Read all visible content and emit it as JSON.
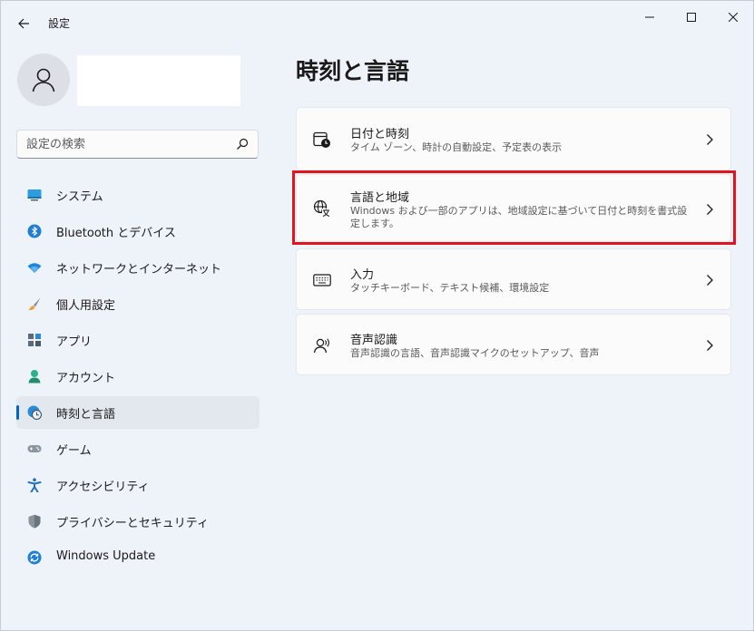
{
  "window": {
    "title": "設定"
  },
  "search": {
    "placeholder": "設定の検索"
  },
  "nav": {
    "items": [
      {
        "label": "システム"
      },
      {
        "label": "Bluetooth とデバイス"
      },
      {
        "label": "ネットワークとインターネット"
      },
      {
        "label": "個人用設定"
      },
      {
        "label": "アプリ"
      },
      {
        "label": "アカウント"
      },
      {
        "label": "時刻と言語"
      },
      {
        "label": "ゲーム"
      },
      {
        "label": "アクセシビリティ"
      },
      {
        "label": "プライバシーとセキュリティ"
      },
      {
        "label": "Windows Update"
      }
    ],
    "selected": "時刻と言語"
  },
  "main": {
    "title": "時刻と言語",
    "cards": [
      {
        "title": "日付と時刻",
        "subtitle": "タイム ゾーン、時計の自動設定、予定表の表示"
      },
      {
        "title": "言語と地域",
        "subtitle": "Windows および一部のアプリは、地域設定に基づいて日付と時刻を書式設定します。"
      },
      {
        "title": "入力",
        "subtitle": "タッチキーボード、テキスト候補、環境設定"
      },
      {
        "title": "音声認識",
        "subtitle": "音声認識の言語、音声認識マイクのセットアップ、音声"
      }
    ]
  },
  "colors": {
    "accent": "#0067c0",
    "highlight": "#e0151e",
    "background": "#eef2f9",
    "card": "#fbfbfc"
  },
  "icons": {
    "nav": [
      "display-icon",
      "bluetooth-icon",
      "wifi-icon",
      "brush-icon",
      "apps-icon",
      "person-icon",
      "time-language-icon",
      "gamepad-icon",
      "accessibility-icon",
      "shield-icon",
      "windows-update-icon"
    ],
    "cards": [
      "calendar-clock-icon",
      "language-globe-icon",
      "keyboard-icon",
      "speech-icon"
    ]
  }
}
